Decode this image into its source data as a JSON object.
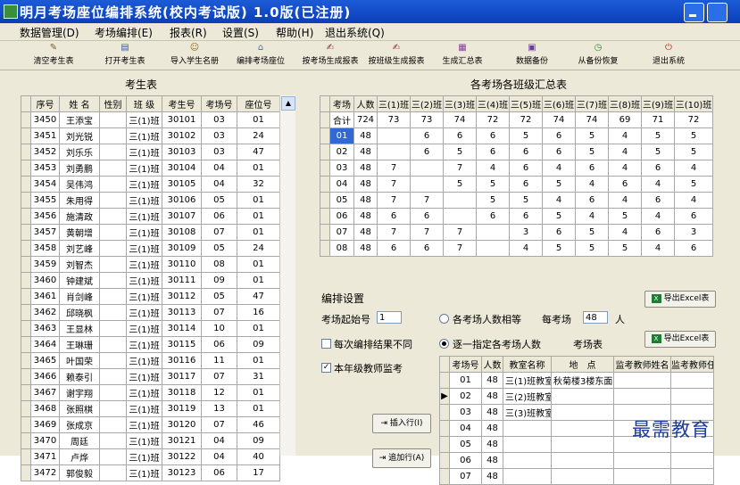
{
  "window": {
    "title": "明月考场座位编排系统(校内考试版) 1.0版(已注册)"
  },
  "menu": [
    "数据管理(D)",
    "考场编排(E)",
    "报表(R)",
    "设置(S)",
    "帮助(H)",
    "退出系统(Q)"
  ],
  "toolbar": [
    {
      "label": "清空考生表",
      "icon": "broom-icon"
    },
    {
      "label": "打开考生表",
      "icon": "open-table-icon"
    },
    {
      "label": "导入学生名册",
      "icon": "import-people-icon"
    },
    {
      "label": "编排考场座位",
      "icon": "house-icon"
    },
    {
      "label": "按考场生成报表",
      "icon": "report-icon"
    },
    {
      "label": "按班级生成报表",
      "icon": "report-icon"
    },
    {
      "label": "生成汇总表",
      "icon": "summary-icon"
    },
    {
      "label": "数据备份",
      "icon": "backup-icon"
    },
    {
      "label": "从备份恢复",
      "icon": "restore-icon"
    },
    {
      "label": "退出系统",
      "icon": "exit-icon"
    }
  ],
  "students": {
    "title": "考生表",
    "columns": [
      "序号",
      "姓 名",
      "性别",
      "班 级",
      "考生号",
      "考场号",
      "座位号"
    ],
    "rows": [
      [
        "3450",
        "王添宝",
        "",
        "三(1)班",
        "30101",
        "03",
        "01"
      ],
      [
        "3451",
        "刘光锐",
        "",
        "三(1)班",
        "30102",
        "03",
        "24"
      ],
      [
        "3452",
        "刘乐乐",
        "",
        "三(1)班",
        "30103",
        "03",
        "47"
      ],
      [
        "3453",
        "刘勇鹏",
        "",
        "三(1)班",
        "30104",
        "04",
        "01"
      ],
      [
        "3454",
        "吴伟鸿",
        "",
        "三(1)班",
        "30105",
        "04",
        "32"
      ],
      [
        "3455",
        "朱用得",
        "",
        "三(1)班",
        "30106",
        "05",
        "01"
      ],
      [
        "3456",
        "施清政",
        "",
        "三(1)班",
        "30107",
        "06",
        "01"
      ],
      [
        "3457",
        "黄朝增",
        "",
        "三(1)班",
        "30108",
        "07",
        "01"
      ],
      [
        "3458",
        "刘艺峰",
        "",
        "三(1)班",
        "30109",
        "05",
        "24"
      ],
      [
        "3459",
        "刘智杰",
        "",
        "三(1)班",
        "30110",
        "08",
        "01"
      ],
      [
        "3460",
        "钟建斌",
        "",
        "三(1)班",
        "30111",
        "09",
        "01"
      ],
      [
        "3461",
        "肖剑峰",
        "",
        "三(1)班",
        "30112",
        "05",
        "47"
      ],
      [
        "3462",
        "邱晓枫",
        "",
        "三(1)班",
        "30113",
        "07",
        "16"
      ],
      [
        "3463",
        "王显林",
        "",
        "三(1)班",
        "30114",
        "10",
        "01"
      ],
      [
        "3464",
        "王琳珊",
        "",
        "三(1)班",
        "30115",
        "06",
        "09"
      ],
      [
        "3465",
        "叶国荣",
        "",
        "三(1)班",
        "30116",
        "11",
        "01"
      ],
      [
        "3466",
        "赖泰引",
        "",
        "三(1)班",
        "30117",
        "07",
        "31"
      ],
      [
        "3467",
        "谢宇翔",
        "",
        "三(1)班",
        "30118",
        "12",
        "01"
      ],
      [
        "3468",
        "张照棋",
        "",
        "三(1)班",
        "30119",
        "13",
        "01"
      ],
      [
        "3469",
        "张成京",
        "",
        "三(1)班",
        "30120",
        "07",
        "46"
      ],
      [
        "3470",
        "周廷",
        "",
        "三(1)班",
        "30121",
        "04",
        "09"
      ],
      [
        "3471",
        "卢烨",
        "",
        "三(1)班",
        "30122",
        "04",
        "40"
      ],
      [
        "3472",
        "郭俊毅",
        "",
        "三(1)班",
        "30123",
        "06",
        "17"
      ]
    ]
  },
  "summary": {
    "title": "各考场各班级汇总表",
    "columns": [
      "考场",
      "人数",
      "三(1)班",
      "三(2)班",
      "三(3)班",
      "三(4)班",
      "三(5)班",
      "三(6)班",
      "三(7)班",
      "三(8)班",
      "三(9)班",
      "三(10)班"
    ],
    "rows": [
      [
        "合计",
        "724",
        "73",
        "73",
        "74",
        "72",
        "72",
        "74",
        "74",
        "69",
        "71",
        "72"
      ],
      [
        "01",
        "48",
        "",
        "6",
        "6",
        "6",
        "5",
        "6",
        "5",
        "4",
        "5",
        "5"
      ],
      [
        "02",
        "48",
        "",
        "6",
        "5",
        "6",
        "6",
        "6",
        "5",
        "4",
        "5",
        "5"
      ],
      [
        "03",
        "48",
        "7",
        "",
        "7",
        "4",
        "6",
        "4",
        "6",
        "4",
        "6",
        "4"
      ],
      [
        "04",
        "48",
        "7",
        "",
        "5",
        "5",
        "6",
        "5",
        "4",
        "6",
        "4",
        "5"
      ],
      [
        "05",
        "48",
        "7",
        "7",
        "",
        "5",
        "5",
        "4",
        "6",
        "4",
        "6",
        "4"
      ],
      [
        "06",
        "48",
        "6",
        "6",
        "",
        "6",
        "6",
        "5",
        "4",
        "5",
        "4",
        "6"
      ],
      [
        "07",
        "48",
        "7",
        "7",
        "7",
        "",
        "3",
        "6",
        "5",
        "4",
        "6",
        "3"
      ],
      [
        "08",
        "48",
        "6",
        "6",
        "7",
        "",
        "4",
        "5",
        "5",
        "5",
        "4",
        "6"
      ]
    ]
  },
  "settings": {
    "title": "编排设置",
    "start_label": "考场起始号",
    "start_value": "1",
    "radio_equal": "各考场人数相等",
    "per_room_label": "每考场",
    "per_room_value": "48",
    "per_room_unit": "人",
    "check_diff": "每次编排结果不同",
    "radio_assign": "逐一指定各考场人数",
    "check_teacher": "本年级教师监考",
    "check_teacher_mark": "✓",
    "rooms_title": "考场表",
    "export1": "导出Excel表",
    "export2": "导出Excel表",
    "insert_btn": "插入行(I)",
    "add_btn": "追加行(A)"
  },
  "rooms": {
    "columns": [
      "考场号",
      "人数",
      "教室名称",
      "地　点",
      "监考教师姓名",
      "监考教师任"
    ],
    "rows": [
      [
        "01",
        "48",
        "三(1)班教室",
        "秋菊楼3楼东面",
        "",
        ""
      ],
      [
        "02",
        "48",
        "三(2)班教室",
        "",
        "",
        ""
      ],
      [
        "03",
        "48",
        "三(3)班教室",
        "",
        "",
        ""
      ],
      [
        "04",
        "48",
        "",
        "",
        "",
        ""
      ],
      [
        "05",
        "48",
        "",
        "",
        "",
        ""
      ],
      [
        "06",
        "48",
        "",
        "",
        "",
        ""
      ],
      [
        "07",
        "48",
        "",
        "",
        "",
        ""
      ]
    ]
  },
  "watermark": "最需教育"
}
